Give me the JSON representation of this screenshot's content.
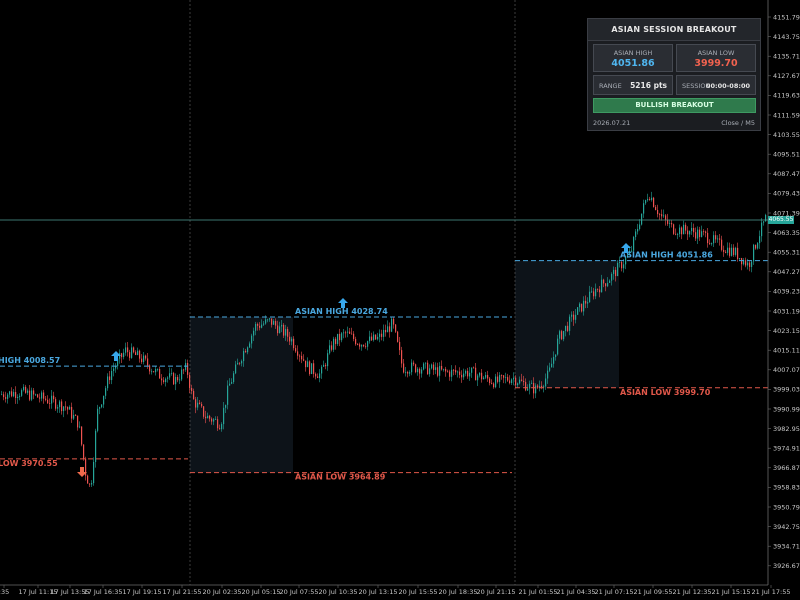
{
  "panel": {
    "title": "ASIAN SESSION BREAKOUT",
    "asian_high_label": "ASIAN HIGH",
    "asian_high_value": "4051.86",
    "asian_low_label": "ASIAN LOW",
    "asian_low_value": "3999.70",
    "range_label": "RANGE",
    "range_value": "5216 pts",
    "session_label": "SESSION",
    "session_value": "00:00-08:00",
    "bias": "BULLISH BREAKOUT",
    "date": "2026.07.21",
    "mode": "Close / M5"
  },
  "price_axis": [
    "4151.79",
    "4143.75",
    "4135.71",
    "4127.67",
    "4119.63",
    "4111.59",
    "4103.55",
    "4095.51",
    "4087.47",
    "4079.43",
    "4071.39",
    "4063.35",
    "4055.31",
    "4047.27",
    "4039.23",
    "4031.19",
    "4023.15",
    "4015.11",
    "4007.07",
    "3999.03",
    "3990.99",
    "3982.95",
    "3974.91",
    "3966.87",
    "3958.83",
    "3950.79",
    "3942.75",
    "3934.71",
    "3926.67"
  ],
  "current_price_tag": "4065.55",
  "time_axis": [
    ":35",
    "17 Jul 11:15",
    "17 Jul 13:55",
    "17 Jul 16:35",
    "17 Jul 19:15",
    "17 Jul 21:55",
    "20 Jul 02:35",
    "20 Jul 05:15",
    "20 Jul 07:55",
    "20 Jul 10:35",
    "20 Jul 13:15",
    "20 Jul 15:55",
    "20 Jul 18:35",
    "20 Jul 21:15",
    "21 Jul 01:55",
    "21 Jul 04:35",
    "21 Jul 07:15",
    "21 Jul 09:55",
    "21 Jul 12:35",
    "21 Jul 15:15",
    "21 Jul 17:55"
  ],
  "levels": [
    {
      "text": "HIGH  4008.57",
      "price": 4008.57,
      "color": "#4aa8e0"
    },
    {
      "text": "LOW   3970.55",
      "price": 3970.55,
      "color": "#e2584a"
    },
    {
      "text": "ASIAN HIGH  4028.74",
      "price": 4028.74,
      "color": "#4aa8e0"
    },
    {
      "text": "ASIAN LOW   3964.89",
      "price": 3964.89,
      "color": "#e2584a"
    },
    {
      "text": "ASIAN HIGH  4051.86",
      "price": 4051.86,
      "color": "#4aa8e0"
    },
    {
      "text": "ASIAN LOW   3999.70",
      "price": 3999.7,
      "color": "#e2584a"
    }
  ],
  "colors": {
    "bull": "#26a69a",
    "bear": "#ef5350",
    "high_line": "#4aa8e0",
    "low_line": "#e2584a",
    "current_line": "#4f9e96"
  }
}
